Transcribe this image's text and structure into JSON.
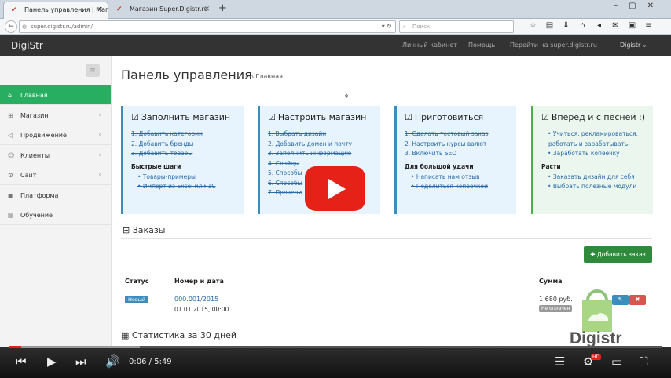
{
  "browser": {
    "tabs": [
      {
        "label": "Панель управления | Мага..."
      },
      {
        "label": "Магазин Super.Digistr.ru"
      }
    ],
    "url": "super.digistr.ru/admin/",
    "search_placeholder": "Поиск"
  },
  "app": {
    "brand": "DigiStr",
    "header_links": [
      "Личный кабинет",
      "Помощь",
      "Перейти на super.digistr.ru",
      "Digistr"
    ]
  },
  "sidebar": {
    "items": [
      {
        "label": "Главная"
      },
      {
        "label": "Магазин"
      },
      {
        "label": "Продвижение"
      },
      {
        "label": "Клиенты"
      },
      {
        "label": "Сайт"
      },
      {
        "label": "Платформа"
      },
      {
        "label": "Обучение"
      }
    ]
  },
  "page": {
    "title": "Панель управления",
    "breadcrumb": "Главная"
  },
  "cards": [
    {
      "title": "Заполнить магазин",
      "items": [
        "1. Добавить категории",
        "2. Добавить бренды",
        "3. Добавить товары"
      ],
      "subtitle": "Быстрые шаги",
      "subitems": [
        "Товары-примеры",
        "Импорт из Excel или 1С"
      ]
    },
    {
      "title": "Настроить магазин",
      "items": [
        "1. Выбрать дизайн",
        "2. Добавить домен и почту",
        "3. Заполнить информацию",
        "4. Слайды",
        "5. Способы",
        "6. Способы",
        "7. Провери"
      ]
    },
    {
      "title": "Приготовиться",
      "items": [
        "1. Сделать тестовый заказ",
        "2. Настроить курсы валют",
        "3. Включить SEO"
      ],
      "subtitle": "Для большой удачи",
      "subitems": [
        "Написать нам отзыв",
        "Поделиться копеечкой"
      ]
    },
    {
      "title": "Вперед и с песней :)",
      "items": [
        "Учиться, рекламироваться,",
        "работать и зарабатывать",
        "Заработать копеечку"
      ],
      "subtitle": "Расти",
      "subitems": [
        "Заказать дизайн для себя",
        "Выбрать полезные модули"
      ]
    }
  ],
  "orders": {
    "title": "Заказы",
    "add_button": "Добавить заказ",
    "columns": {
      "status": "Статус",
      "number": "Номер и дата",
      "sum": "Сумма"
    },
    "row": {
      "status": "Новый",
      "number": "000.001/2015",
      "date": "01.01.2015, 00:00",
      "sum": "1 680 руб.",
      "payment": "Не оплачен"
    }
  },
  "stats": {
    "title": "Статистика за 30 дней"
  },
  "watermark": {
    "text": "Digistr"
  },
  "player": {
    "current": "0:06",
    "total": "5:49",
    "progress_fraction": 0.018,
    "buffered_fraction": 0.2,
    "hd_badge": "HD"
  },
  "colors": {
    "accent_green": "#27ae60",
    "card_blue": "#e7f3fd",
    "card_green": "#eaf6ee",
    "header_dark": "#333333",
    "yt_red": "#e62117"
  }
}
